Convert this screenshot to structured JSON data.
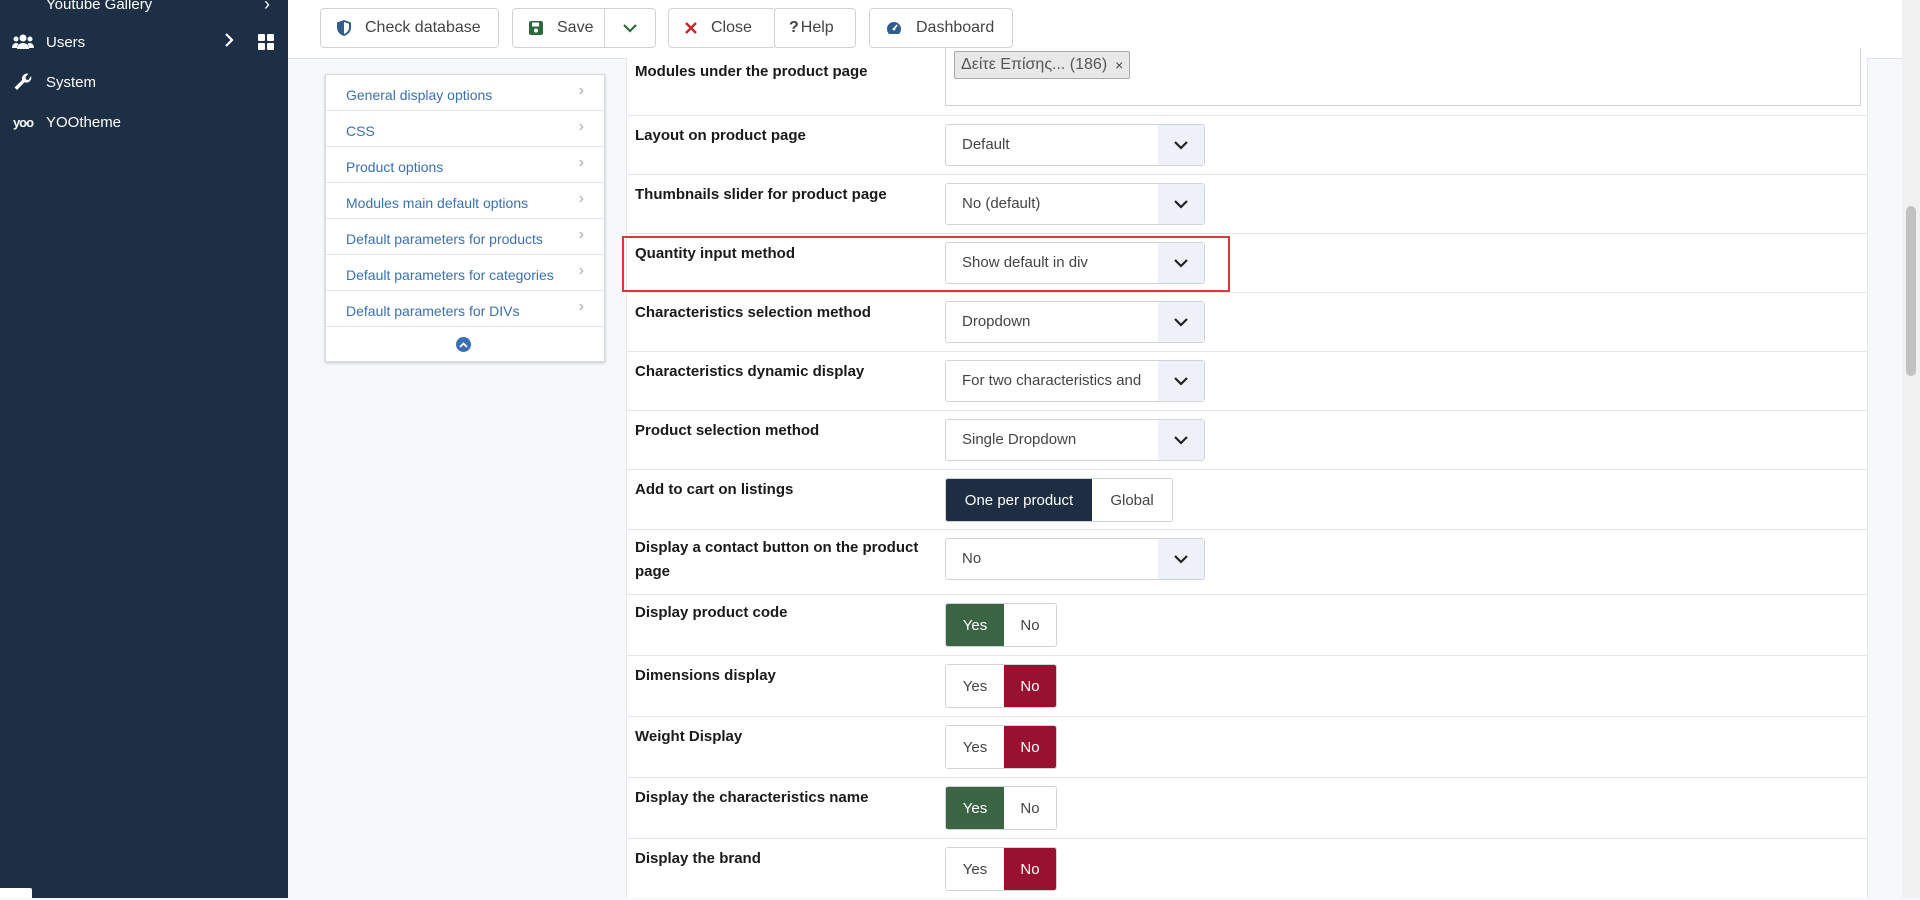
{
  "sidebar": {
    "items": [
      {
        "label": "Youtube Gallery",
        "icon": "chevron-right-icon"
      },
      {
        "label": "Users",
        "icon": "users-icon"
      },
      {
        "label": "System",
        "icon": "wrench-icon"
      },
      {
        "label": "YOOtheme",
        "icon": "yootheme-logo"
      }
    ]
  },
  "toolbar": {
    "check_database": "Check database",
    "save": "Save",
    "close": "Close",
    "help": "Help",
    "dashboard": "Dashboard"
  },
  "left_menu": {
    "items": [
      "General display options",
      "CSS",
      "Product options",
      "Modules main default options",
      "Default parameters for products",
      "Default parameters for categories",
      "Default parameters for DIVs"
    ]
  },
  "form": {
    "modules_under_product": {
      "label": "Modules under the product page",
      "tag": "Δείτε Επίσης... (186)",
      "tag_remove": "×"
    },
    "layout_product": {
      "label": "Layout on product page",
      "value": "Default"
    },
    "thumbnails_slider": {
      "label": "Thumbnails slider for product page",
      "value": "No (default)"
    },
    "quantity_input": {
      "label": "Quantity input method",
      "value": "Show default in div"
    },
    "characteristics_selection": {
      "label": "Characteristics selection method",
      "value": "Dropdown"
    },
    "characteristics_dynamic": {
      "label": "Characteristics dynamic display",
      "value": "For two characteristics and"
    },
    "product_selection": {
      "label": "Product selection method",
      "value": "Single Dropdown"
    },
    "add_to_cart": {
      "label": "Add to cart on listings",
      "options": [
        "One per product",
        "Global"
      ],
      "selected": "One per product"
    },
    "contact_button": {
      "label": "Display a contact button on the product page",
      "value": "No"
    },
    "product_code": {
      "label": "Display product code",
      "yes": "Yes",
      "no": "No",
      "selected": "Yes"
    },
    "dimensions": {
      "label": "Dimensions display",
      "yes": "Yes",
      "no": "No",
      "selected": "No"
    },
    "weight": {
      "label": "Weight Display",
      "yes": "Yes",
      "no": "No",
      "selected": "No"
    },
    "characteristics_name": {
      "label": "Display the characteristics name",
      "yes": "Yes",
      "no": "No",
      "selected": "Yes"
    },
    "brand": {
      "label": "Display the brand",
      "yes": "Yes",
      "no": "No",
      "selected": "No"
    }
  },
  "colors": {
    "sidebar": "#1c2f45",
    "link": "#3a70b3",
    "dark_active": "#1e2d42",
    "green_active": "#3b6445",
    "red_active": "#981230",
    "highlight": "#d9363e"
  }
}
